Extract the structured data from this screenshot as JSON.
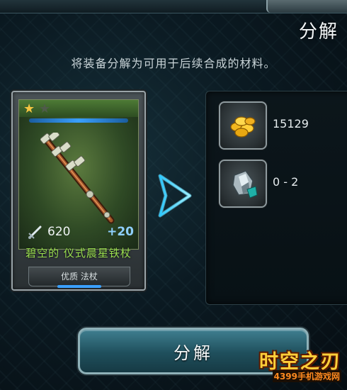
{
  "header": {
    "title": "分解",
    "subtitle": "将装备分解为可用于后续合成的材料。"
  },
  "item_card": {
    "stars_filled": 1,
    "stars_total": 2,
    "attack": "620",
    "bonus": "+20",
    "name": "碧空的 仪式晨星铁杖",
    "type": "优质 法杖",
    "weapon_icon": "mace-staff-icon"
  },
  "results": [
    {
      "icon": "gold-coins-icon",
      "value": "15129"
    },
    {
      "icon": "crystal-shard-icon",
      "value": "0 - 2"
    }
  ],
  "actions": {
    "decompose_label": "分解"
  },
  "watermark": {
    "title": "时空之刃",
    "site": "4399手机游戏网"
  },
  "colors": {
    "item_name": "#9be050",
    "accent_blue": "#3aa0ff",
    "gold": "#f5c542"
  }
}
